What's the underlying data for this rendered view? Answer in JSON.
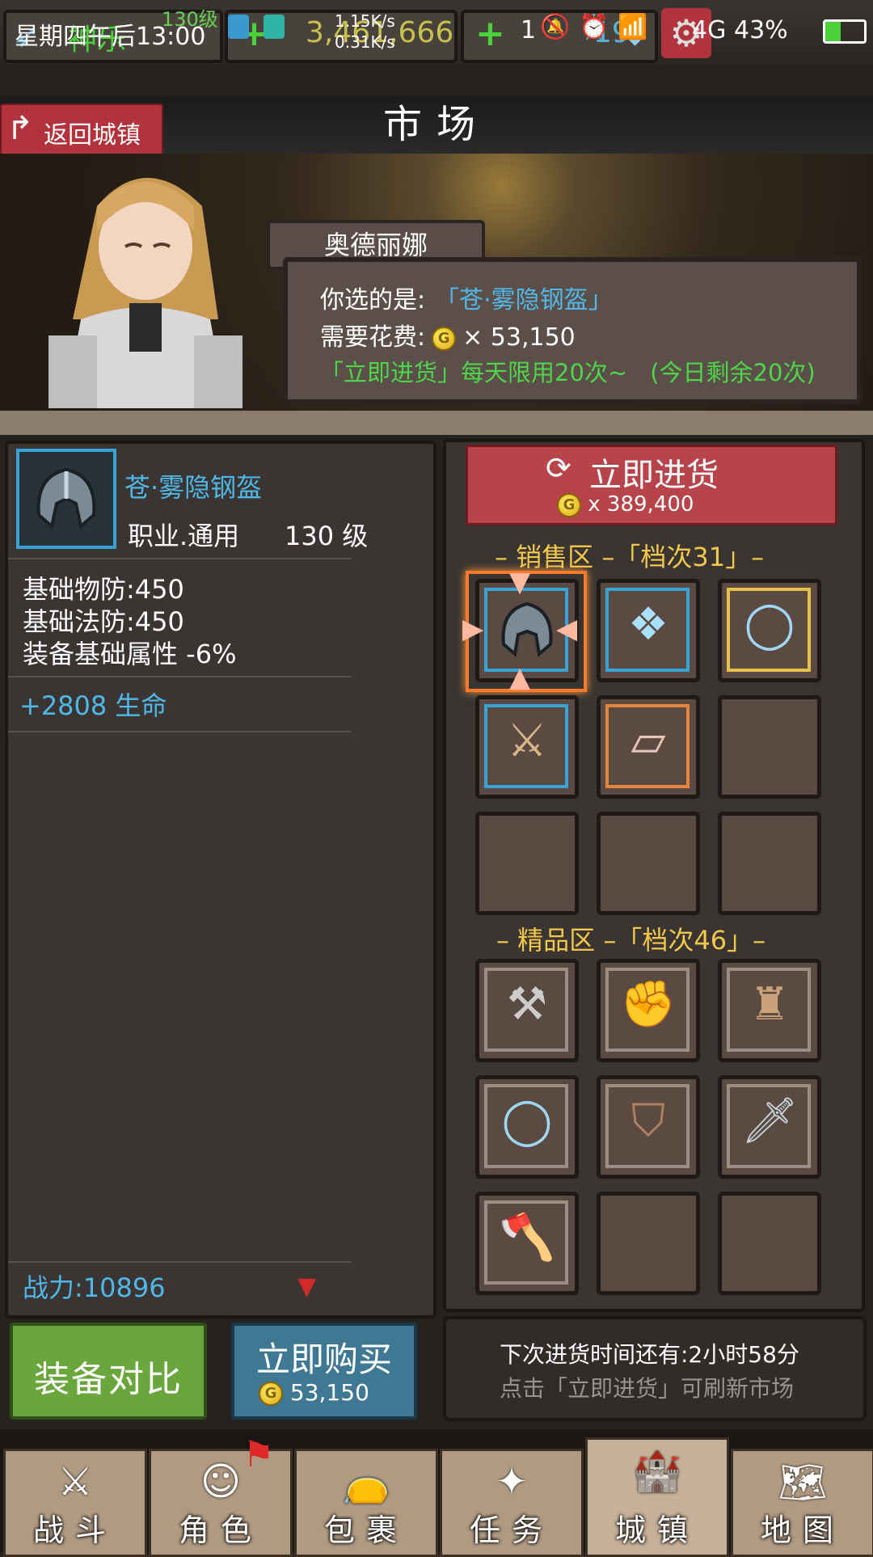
{
  "status_bar": {
    "time": "星期四午后13:00",
    "net_up": "1.15K/s",
    "net_down": "0.31K/s",
    "notif_count": "1",
    "network": "4G",
    "battery": "43%"
  },
  "resources": {
    "player_name": "神乐",
    "level_badge": "130级",
    "gold": "3,461,666",
    "gems": "19"
  },
  "header": {
    "title": "市场",
    "back_label": "返回城镇"
  },
  "npc": {
    "name": "奥德丽娜",
    "selected_prefix": "你选的是:",
    "selected_item": "「苍·雾隐钢盔」",
    "cost_prefix": "需要花费:",
    "cost_value": "× 53,150",
    "restock_note": "「立即进货」每天限用20次~",
    "remaining_note": "(今日剩余20次)"
  },
  "item": {
    "name": "苍·雾隐钢盔",
    "class_label": "职业.通用",
    "level": "130 级",
    "stats": [
      "基础物防:450",
      "基础法防:450",
      "装备基础属性 -6%"
    ],
    "bonus": "+2808 生命",
    "power": "战力:10896"
  },
  "restock": {
    "label": "立即进货",
    "cost": "x 389,400"
  },
  "sale_section": {
    "label": "– 销售区 –「档次31」–"
  },
  "premium_section": {
    "label": "– 精品区 –「档次46」–"
  },
  "buttons": {
    "compare": "装备对比",
    "buy": "立即购买",
    "buy_cost": "53,150"
  },
  "info": {
    "line1": "下次进货时间还有:2小时58分",
    "line2": "点击「立即进货」可刷新市场"
  },
  "nav": [
    {
      "label": "战斗",
      "icon": "crossed-swords-icon"
    },
    {
      "label": "角色",
      "icon": "character-face-icon"
    },
    {
      "label": "包裹",
      "icon": "bag-icon"
    },
    {
      "label": "任务",
      "icon": "quest-icon"
    },
    {
      "label": "城镇",
      "icon": "castle-icon"
    },
    {
      "label": "地图",
      "icon": "map-icon"
    }
  ],
  "colors": {
    "blue_frame": "#3aa3d6",
    "gold_frame": "#e4c246",
    "orange_frame": "#e2863c",
    "accent_text": "#4fb8e8",
    "green_text": "#4ed64a",
    "section_text": "#f2c84b"
  }
}
